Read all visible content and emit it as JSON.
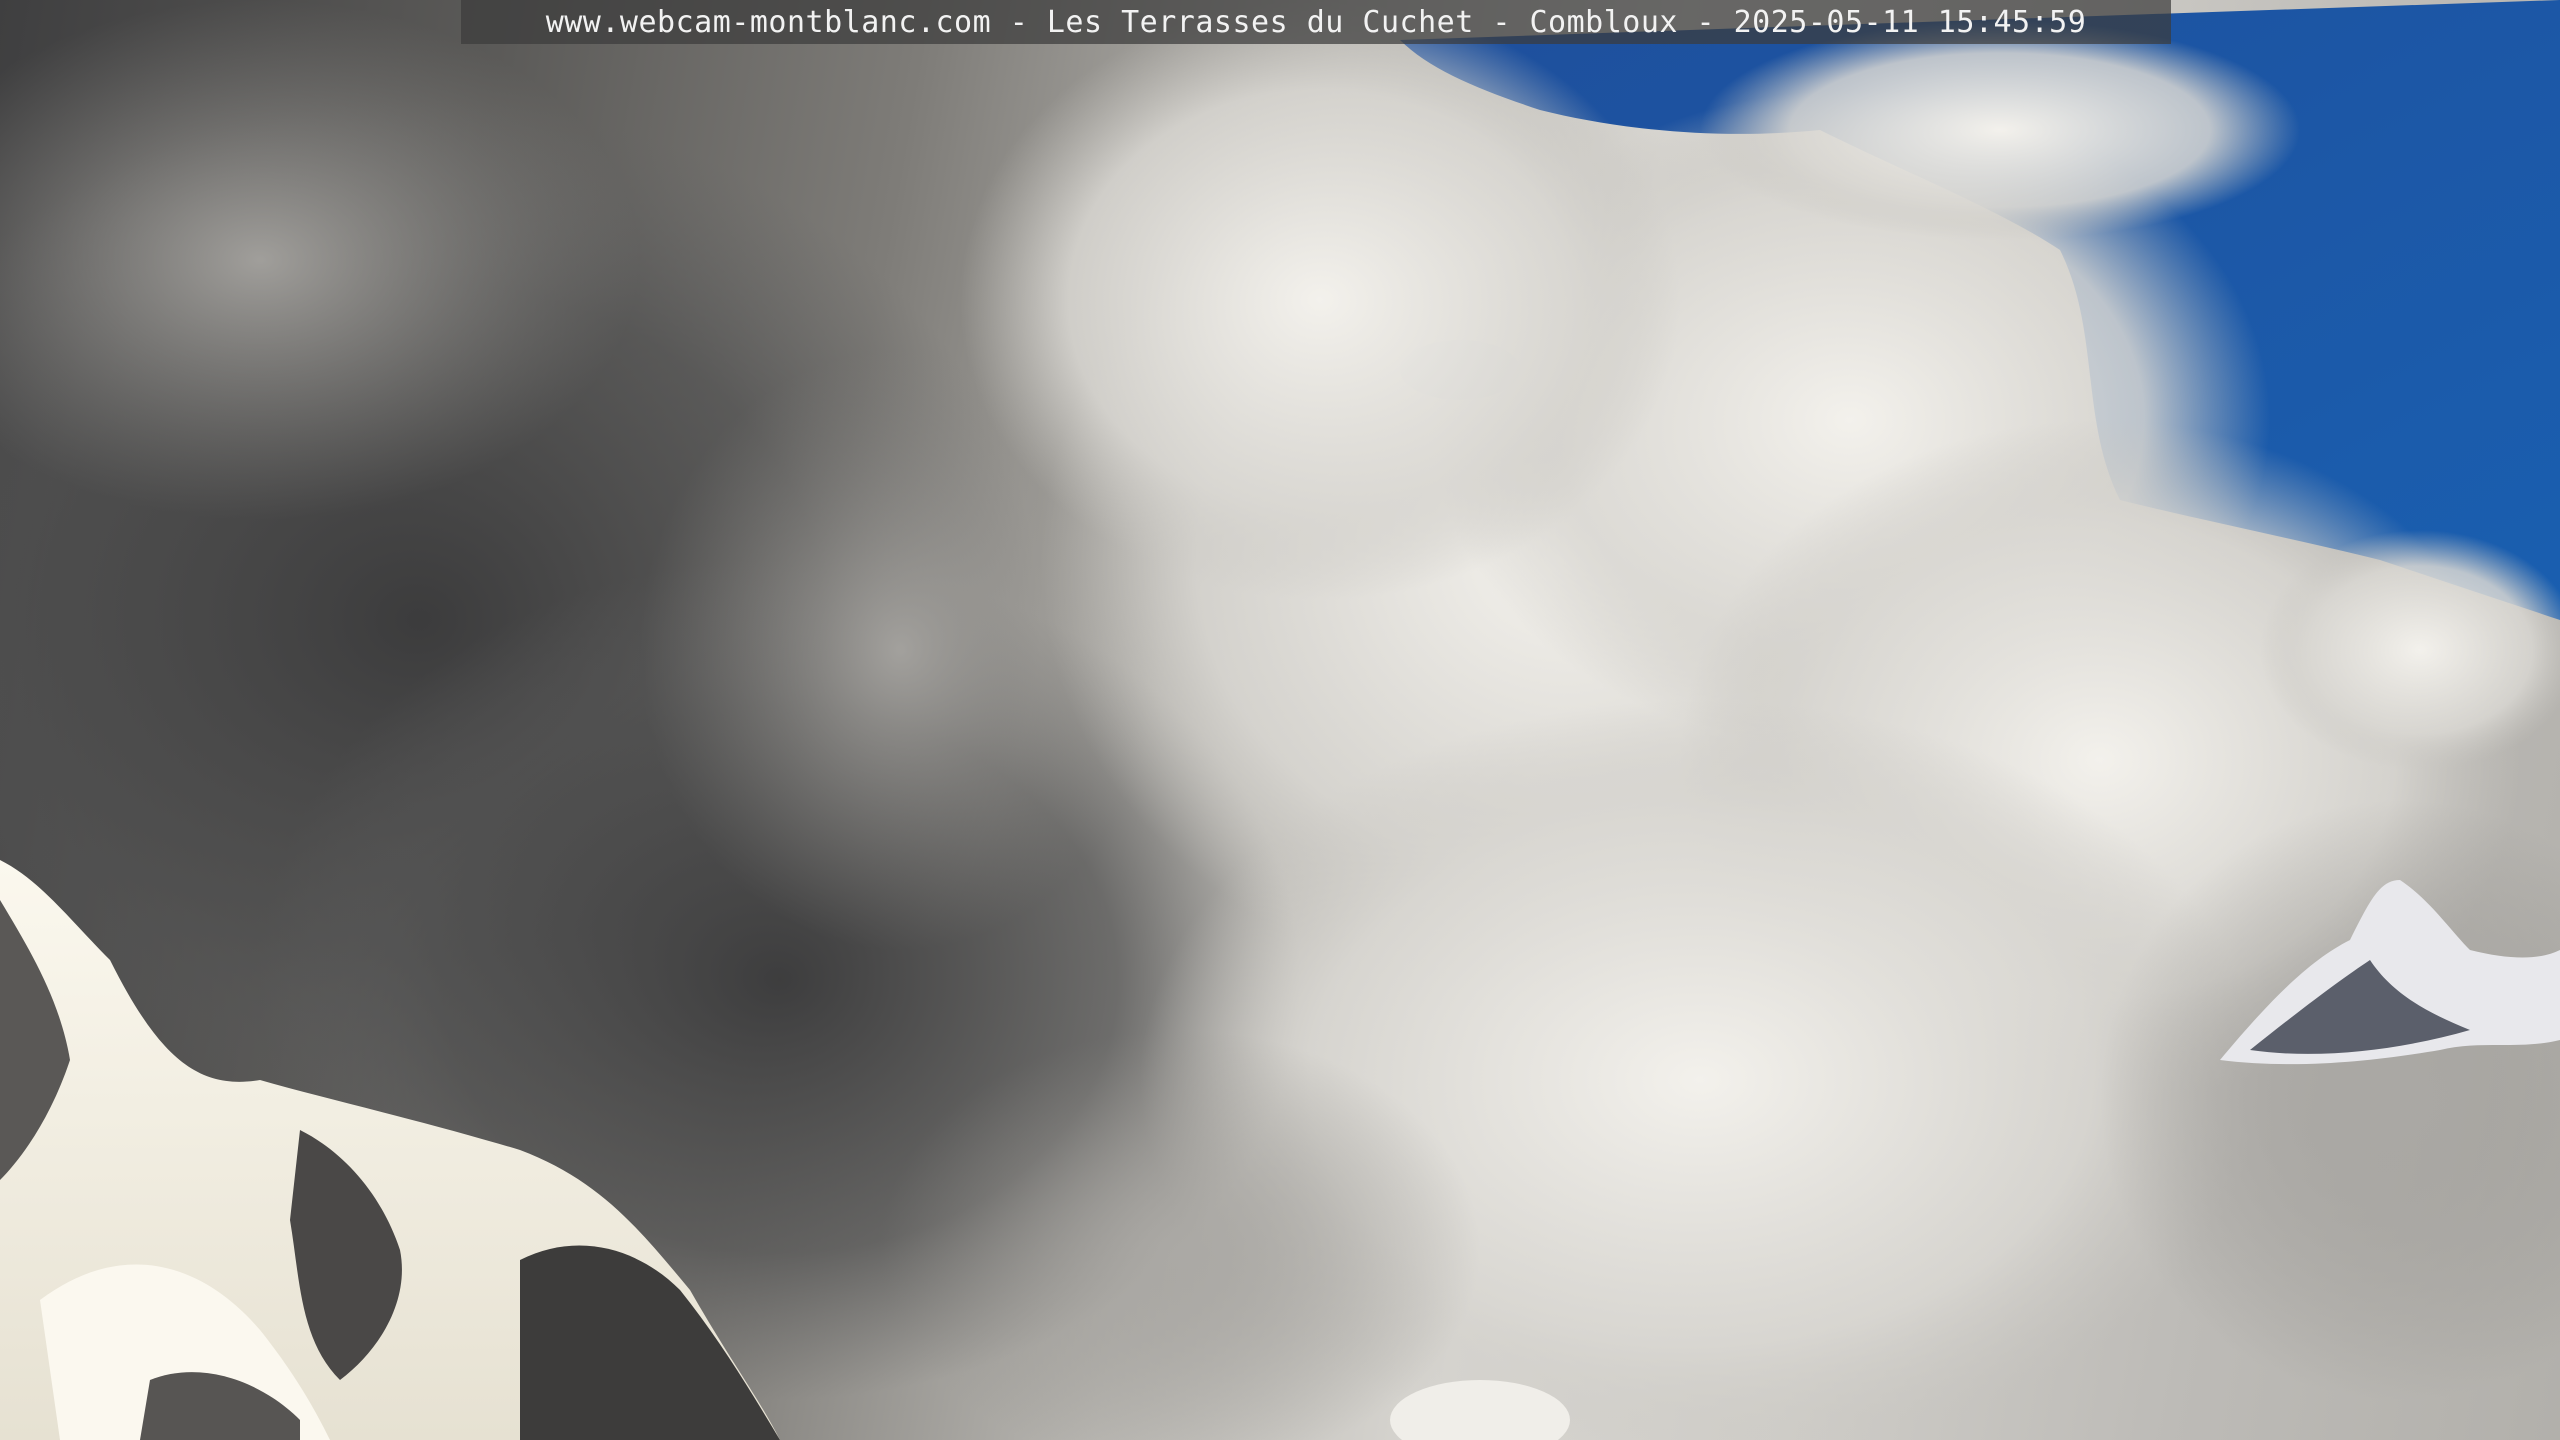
{
  "webcam": {
    "caption": "www.webcam-montblanc.com - Les Terrasses du Cuchet - Combloux - 2025-05-11 15:45:59"
  },
  "colors": {
    "sky_blue": "#1f58a8",
    "cloud_dark": "#4a4a4b",
    "cloud_light": "#e6e4df",
    "snow": "#f4f1e6",
    "rock": "#3b3a3a",
    "caption_bar": "#3c3c3c"
  }
}
